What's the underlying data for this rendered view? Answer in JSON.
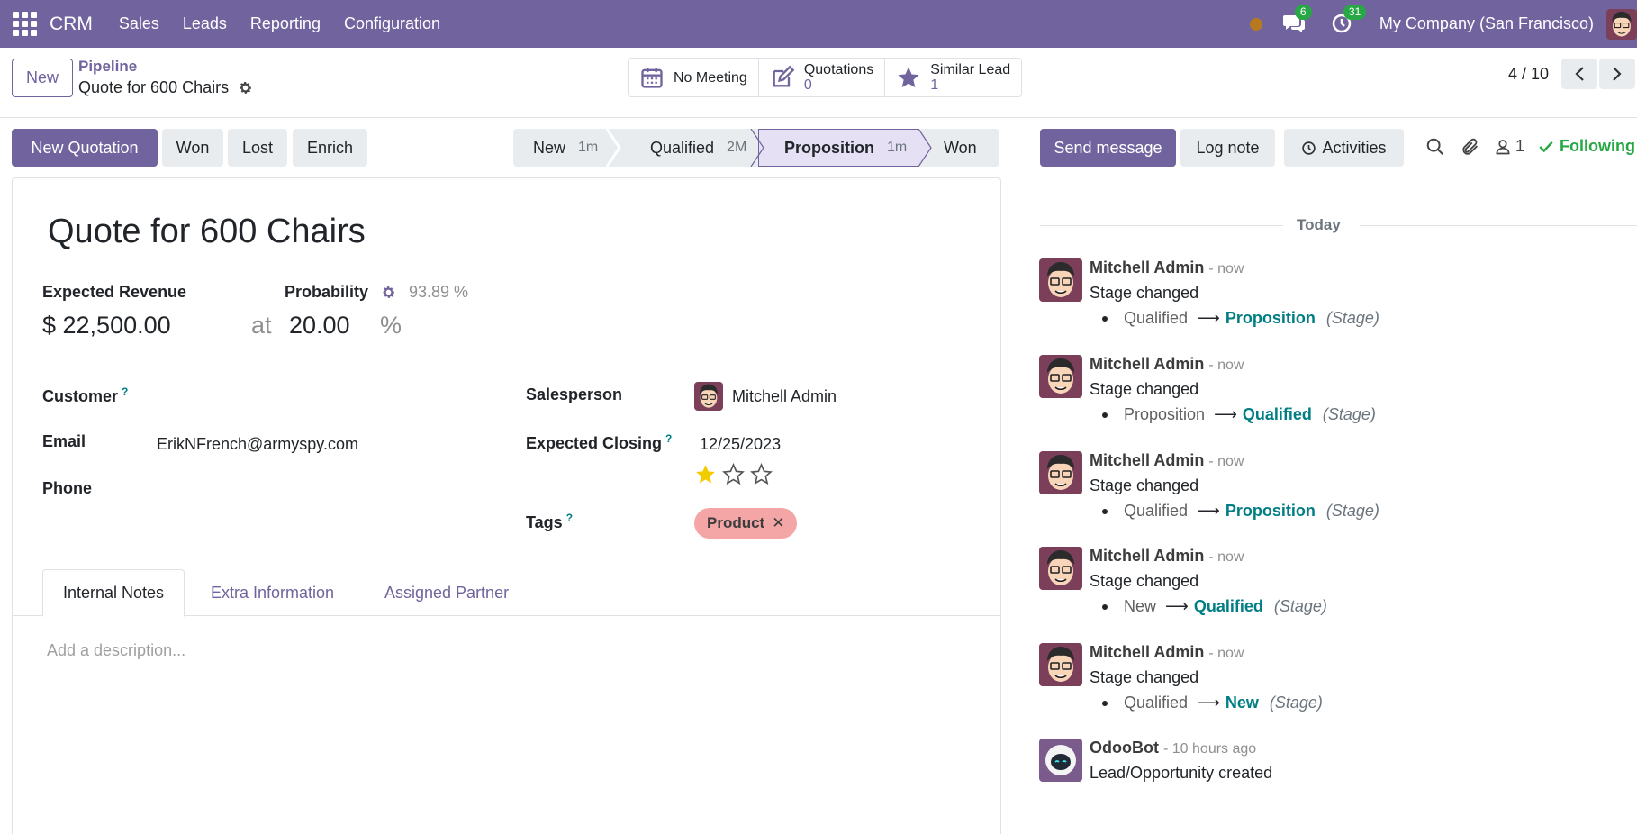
{
  "navbar": {
    "brand": "CRM",
    "menu": [
      "Sales",
      "Leads",
      "Reporting",
      "Configuration"
    ],
    "messages_count": "6",
    "activities_count": "31",
    "company": "My Company (San Francisco)"
  },
  "control": {
    "new_label": "New",
    "breadcrumb_parent": "Pipeline",
    "breadcrumb_current": "Quote for 600 Chairs",
    "smart_buttons": {
      "meeting_label": "No Meeting",
      "quotations_label": "Quotations",
      "quotations_value": "0",
      "similar_label": "Similar Lead",
      "similar_value": "1"
    },
    "pager": "4 / 10"
  },
  "actions": {
    "new_quotation": "New Quotation",
    "won": "Won",
    "lost": "Lost",
    "enrich": "Enrich"
  },
  "stages": [
    {
      "name": "New",
      "duration": "1m"
    },
    {
      "name": "Qualified",
      "duration": "2M"
    },
    {
      "name": "Proposition",
      "duration": "1m"
    },
    {
      "name": "Won",
      "duration": ""
    }
  ],
  "form": {
    "title": "Quote for 600 Chairs",
    "expected_revenue_label": "Expected Revenue",
    "expected_revenue_value": "$ 22,500.00",
    "at_label": "at",
    "probability_label": "Probability",
    "probability_auto": "93.89 %",
    "probability_value": "20.00",
    "percent_sign": "%",
    "customer_label": "Customer",
    "email_label": "Email",
    "email_value": "ErikNFrench@armyspy.com",
    "phone_label": "Phone",
    "salesperson_label": "Salesperson",
    "salesperson_value": "Mitchell Admin",
    "expected_closing_label": "Expected Closing",
    "expected_closing_value": "12/25/2023",
    "priority_stars": 1,
    "tags_label": "Tags",
    "tag_value": "Product",
    "help_mark": "?",
    "tabs": [
      "Internal Notes",
      "Extra Information",
      "Assigned Partner"
    ],
    "description_placeholder": "Add a description..."
  },
  "chatter": {
    "send_message": "Send message",
    "log_note": "Log note",
    "activities": "Activities",
    "followers_count": "1",
    "following": "Following",
    "today": "Today",
    "messages": [
      {
        "author": "Mitchell Admin",
        "time": "- now",
        "body": "Stage changed",
        "old": "Qualified",
        "new": "Proposition",
        "field": "(Stage)"
      },
      {
        "author": "Mitchell Admin",
        "time": "- now",
        "body": "Stage changed",
        "old": "Proposition",
        "new": "Qualified",
        "field": "(Stage)"
      },
      {
        "author": "Mitchell Admin",
        "time": "- now",
        "body": "Stage changed",
        "old": "Qualified",
        "new": "Proposition",
        "field": "(Stage)"
      },
      {
        "author": "Mitchell Admin",
        "time": "- now",
        "body": "Stage changed",
        "old": "New",
        "new": "Qualified",
        "field": "(Stage)"
      },
      {
        "author": "Mitchell Admin",
        "time": "- now",
        "body": "Stage changed",
        "old": "Qualified",
        "new": "New",
        "field": "(Stage)"
      },
      {
        "author": "OdooBot",
        "time": "- 10 hours ago",
        "body": "Lead/Opportunity created"
      }
    ]
  },
  "colors": {
    "brand": "#71639e",
    "accent_link": "#017e84",
    "following": "#28a745",
    "tag": "#f4a5a5",
    "star": "#f3cc00"
  }
}
